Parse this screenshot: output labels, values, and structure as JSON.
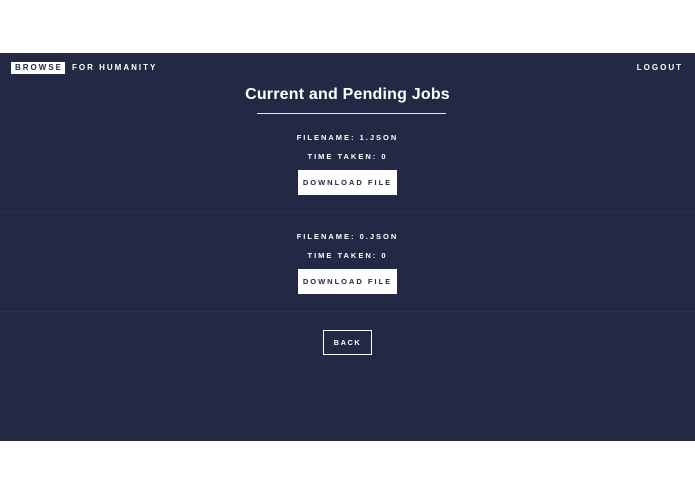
{
  "nav": {
    "brand_box": "BROWSE",
    "brand_rest": "FOR HUMANITY",
    "logout_label": "LOGOUT"
  },
  "main": {
    "title": "Current and Pending Jobs",
    "jobs": [
      {
        "filename": "FILENAME: 1.JSON",
        "time_taken": "TIME TAKEN: 0",
        "download_label": "DOWNLOAD FILE"
      },
      {
        "filename": "FILENAME: 0.JSON",
        "time_taken": "TIME TAKEN: 0",
        "download_label": "DOWNLOAD FILE"
      }
    ],
    "back_label": "BACK"
  },
  "colors": {
    "background": "#232845",
    "text": "#ffffff",
    "page_outer": "#ffffff"
  }
}
